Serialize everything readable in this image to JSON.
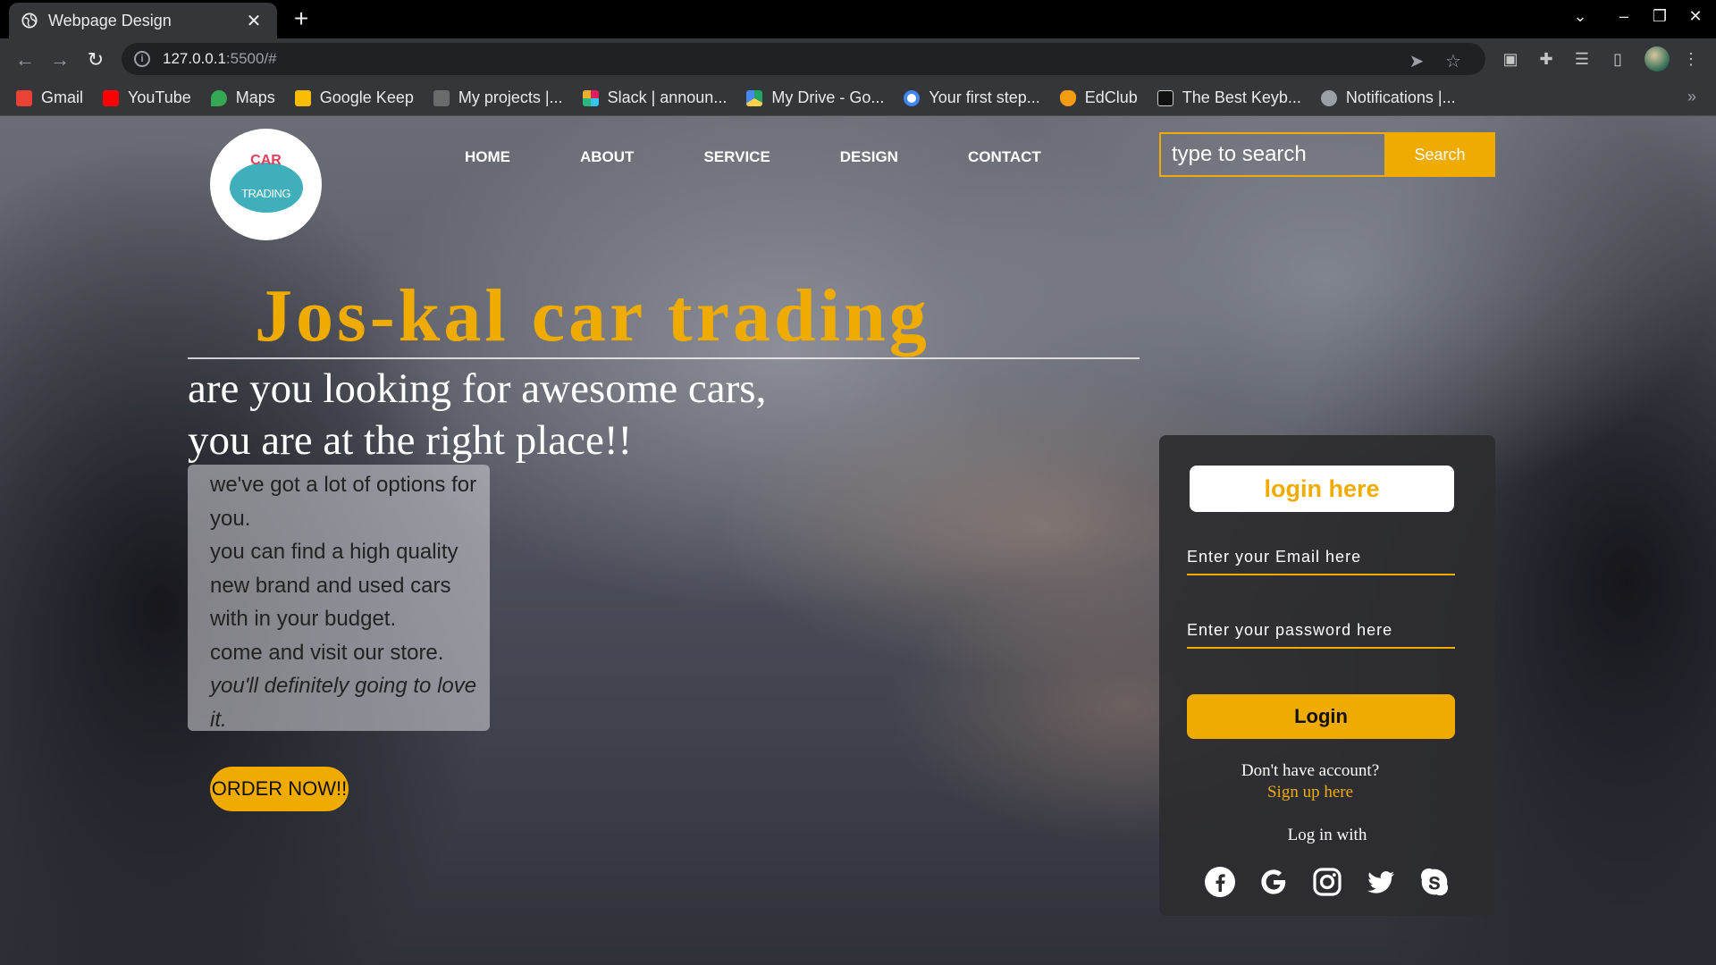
{
  "browser": {
    "tab_title": "Webpage Design",
    "url_host": "127.0.0.1",
    "url_rest": ":5500/#",
    "bookmarks": [
      {
        "label": "Gmail",
        "icon": "gmail-icon",
        "color": "#ea4335"
      },
      {
        "label": "YouTube",
        "icon": "youtube-icon",
        "color": "#ff0000"
      },
      {
        "label": "Maps",
        "icon": "maps-icon",
        "color": "#34a853"
      },
      {
        "label": "Google Keep",
        "icon": "keep-icon",
        "color": "#fbbc04"
      },
      {
        "label": "My projects |...",
        "icon": "olx-icon",
        "color": "#6b6b6b"
      },
      {
        "label": "Slack | announ...",
        "icon": "slack-icon",
        "color": "#e01e5a"
      },
      {
        "label": "My Drive - Go...",
        "icon": "drive-icon",
        "color": "#1fa463"
      },
      {
        "label": "Your first step...",
        "icon": "google-icon",
        "color": "#4285f4"
      },
      {
        "label": "EdClub",
        "icon": "edclub-icon",
        "color": "#f39c12"
      },
      {
        "label": "The Best Keyb...",
        "icon": "htg-icon",
        "color": "#111111"
      },
      {
        "label": "Notifications |...",
        "icon": "notifications-icon",
        "color": "#9aa0a6"
      }
    ]
  },
  "site": {
    "logo_top": "CAR",
    "logo_bottom": "TRADING",
    "nav": [
      "HOME",
      "ABOUT",
      "SERVICE",
      "DESIGN",
      "CONTACT"
    ],
    "search": {
      "placeholder": "type to search",
      "button": "Search"
    },
    "hero": {
      "title": "Jos-kal car trading",
      "subtitle_line1": "are you looking for awesome cars,",
      "subtitle_line2": "you are at the right place!!"
    },
    "description": {
      "p1": "we've got a lot of options for you.",
      "p2": "you can find a high quality new brand and used cars with in your budget.",
      "p3": "come and visit our store.",
      "p4": "you'll definitely going to love it."
    },
    "order_button": "ORDER NOW!!",
    "login": {
      "heading": "login here",
      "email_placeholder": "Enter your Email here",
      "password_placeholder": "Enter your password here",
      "button": "Login",
      "no_account": "Don't have account?",
      "signup": "Sign up here",
      "login_with": "Log in with",
      "socials": [
        "facebook-icon",
        "google-icon",
        "instagram-icon",
        "twitter-icon",
        "skype-icon"
      ]
    },
    "accent_color": "#f0ab00"
  }
}
